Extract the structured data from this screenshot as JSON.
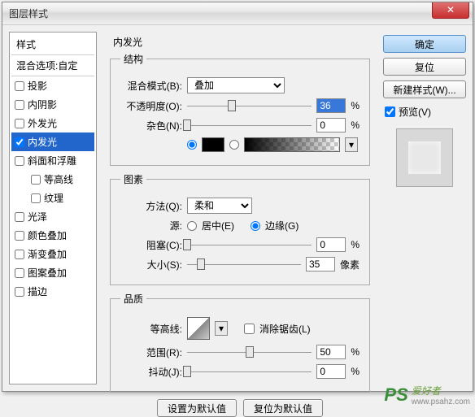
{
  "window": {
    "title": "图层样式"
  },
  "styles": {
    "header": "样式",
    "blend": "混合选项:自定",
    "items": [
      {
        "label": "投影",
        "checked": false
      },
      {
        "label": "内阴影",
        "checked": false
      },
      {
        "label": "外发光",
        "checked": false
      },
      {
        "label": "内发光",
        "checked": true,
        "selected": true
      },
      {
        "label": "斜面和浮雕",
        "checked": false
      },
      {
        "label": "等高线",
        "checked": false,
        "sub": true
      },
      {
        "label": "纹理",
        "checked": false,
        "sub": true
      },
      {
        "label": "光泽",
        "checked": false
      },
      {
        "label": "颜色叠加",
        "checked": false
      },
      {
        "label": "渐变叠加",
        "checked": false
      },
      {
        "label": "图案叠加",
        "checked": false
      },
      {
        "label": "描边",
        "checked": false
      }
    ]
  },
  "main": {
    "title": "内发光",
    "structure": {
      "legend": "结构",
      "blend_label": "混合模式(B):",
      "blend_value": "叠加",
      "opacity_label": "不透明度(O):",
      "opacity_value": "36",
      "opacity_unit": "%",
      "noise_label": "杂色(N):",
      "noise_value": "0",
      "noise_unit": "%"
    },
    "elements": {
      "legend": "图素",
      "method_label": "方法(Q):",
      "method_value": "柔和",
      "source_label": "源:",
      "center_label": "居中(E)",
      "edge_label": "边缘(G)",
      "choke_label": "阻塞(C):",
      "choke_value": "0",
      "choke_unit": "%",
      "size_label": "大小(S):",
      "size_value": "35",
      "size_unit": "像素"
    },
    "quality": {
      "legend": "品质",
      "contour_label": "等高线:",
      "antialias_label": "消除锯齿(L)",
      "range_label": "范围(R):",
      "range_value": "50",
      "range_unit": "%",
      "jitter_label": "抖动(J):",
      "jitter_value": "0",
      "jitter_unit": "%"
    },
    "set_default": "设置为默认值",
    "reset_default": "复位为默认值"
  },
  "right": {
    "ok": "确定",
    "cancel": "复位",
    "new_style": "新建样式(W)...",
    "preview": "预览(V)"
  },
  "watermark": {
    "ps": "PS",
    "text": "爱好者",
    "url": "www.psahz.com"
  }
}
